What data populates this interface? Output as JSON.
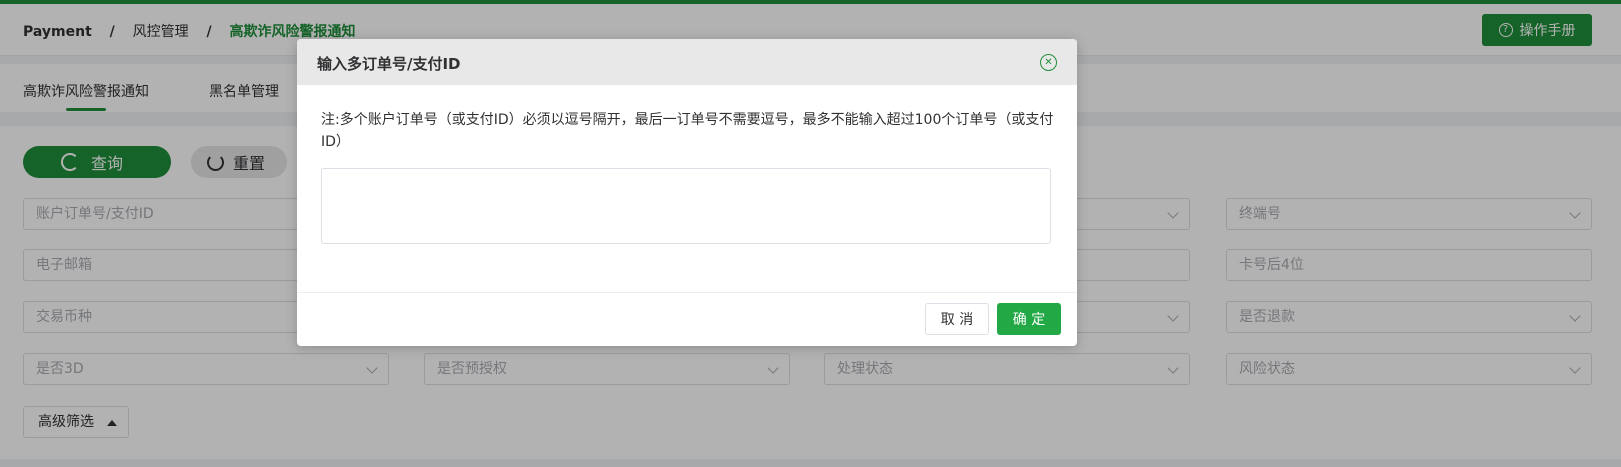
{
  "breadcrumb": {
    "root": "Payment",
    "separator": "/",
    "middle": "风控管理",
    "current": "高欺诈风险警报通知"
  },
  "header": {
    "manual_button": "操作手册",
    "manual_icon": "question-circle-icon"
  },
  "tabs": [
    {
      "label": "高欺诈风险警报通知",
      "active": true
    },
    {
      "label": "黑名单管理",
      "active": false
    }
  ],
  "actions": {
    "query_label": "查询",
    "query_icon": "search-refresh-icon",
    "reset_label": "重置",
    "reset_icon": "reset-icon"
  },
  "filters": {
    "order_id": "账户订单号/支付ID",
    "terminal": "终端号",
    "email": "电子邮箱",
    "card_last4": "卡号后4位",
    "currency": "交易币种",
    "is_refund": "是否退款",
    "is_3d": "是否3D",
    "is_preauth": "是否预授权",
    "process_status": "处理状态",
    "risk_status": "风险状态"
  },
  "advanced_filter_label": "高级筛选",
  "dialog": {
    "title": "输入多订单号/支付ID",
    "close_icon": "close-circle-icon",
    "note": "注:多个账户订单号（或支付ID）必须以逗号隔开，最后一订单号不需要逗号，最多不能输入超过100个订单号（或支付ID）",
    "textarea_value": "",
    "cancel_label": "取 消",
    "confirm_label": "确 定"
  },
  "colors": {
    "brand": "#1f8f3a",
    "confirm": "#22a844",
    "overlay": "rgba(0,0,0,0.30)"
  }
}
